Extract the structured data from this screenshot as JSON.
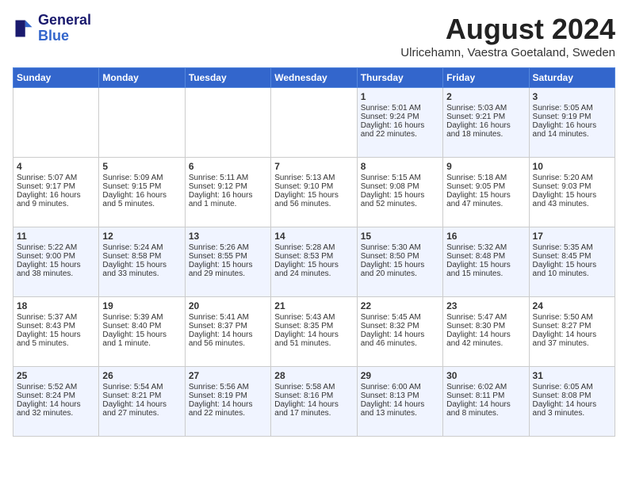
{
  "header": {
    "logo_line1": "General",
    "logo_line2": "Blue",
    "month": "August 2024",
    "location": "Ulricehamn, Vaestra Goetaland, Sweden"
  },
  "days_of_week": [
    "Sunday",
    "Monday",
    "Tuesday",
    "Wednesday",
    "Thursday",
    "Friday",
    "Saturday"
  ],
  "weeks": [
    [
      {
        "day": "",
        "info": ""
      },
      {
        "day": "",
        "info": ""
      },
      {
        "day": "",
        "info": ""
      },
      {
        "day": "",
        "info": ""
      },
      {
        "day": "1",
        "info": "Sunrise: 5:01 AM\nSunset: 9:24 PM\nDaylight: 16 hours\nand 22 minutes."
      },
      {
        "day": "2",
        "info": "Sunrise: 5:03 AM\nSunset: 9:21 PM\nDaylight: 16 hours\nand 18 minutes."
      },
      {
        "day": "3",
        "info": "Sunrise: 5:05 AM\nSunset: 9:19 PM\nDaylight: 16 hours\nand 14 minutes."
      }
    ],
    [
      {
        "day": "4",
        "info": "Sunrise: 5:07 AM\nSunset: 9:17 PM\nDaylight: 16 hours\nand 9 minutes."
      },
      {
        "day": "5",
        "info": "Sunrise: 5:09 AM\nSunset: 9:15 PM\nDaylight: 16 hours\nand 5 minutes."
      },
      {
        "day": "6",
        "info": "Sunrise: 5:11 AM\nSunset: 9:12 PM\nDaylight: 16 hours\nand 1 minute."
      },
      {
        "day": "7",
        "info": "Sunrise: 5:13 AM\nSunset: 9:10 PM\nDaylight: 15 hours\nand 56 minutes."
      },
      {
        "day": "8",
        "info": "Sunrise: 5:15 AM\nSunset: 9:08 PM\nDaylight: 15 hours\nand 52 minutes."
      },
      {
        "day": "9",
        "info": "Sunrise: 5:18 AM\nSunset: 9:05 PM\nDaylight: 15 hours\nand 47 minutes."
      },
      {
        "day": "10",
        "info": "Sunrise: 5:20 AM\nSunset: 9:03 PM\nDaylight: 15 hours\nand 43 minutes."
      }
    ],
    [
      {
        "day": "11",
        "info": "Sunrise: 5:22 AM\nSunset: 9:00 PM\nDaylight: 15 hours\nand 38 minutes."
      },
      {
        "day": "12",
        "info": "Sunrise: 5:24 AM\nSunset: 8:58 PM\nDaylight: 15 hours\nand 33 minutes."
      },
      {
        "day": "13",
        "info": "Sunrise: 5:26 AM\nSunset: 8:55 PM\nDaylight: 15 hours\nand 29 minutes."
      },
      {
        "day": "14",
        "info": "Sunrise: 5:28 AM\nSunset: 8:53 PM\nDaylight: 15 hours\nand 24 minutes."
      },
      {
        "day": "15",
        "info": "Sunrise: 5:30 AM\nSunset: 8:50 PM\nDaylight: 15 hours\nand 20 minutes."
      },
      {
        "day": "16",
        "info": "Sunrise: 5:32 AM\nSunset: 8:48 PM\nDaylight: 15 hours\nand 15 minutes."
      },
      {
        "day": "17",
        "info": "Sunrise: 5:35 AM\nSunset: 8:45 PM\nDaylight: 15 hours\nand 10 minutes."
      }
    ],
    [
      {
        "day": "18",
        "info": "Sunrise: 5:37 AM\nSunset: 8:43 PM\nDaylight: 15 hours\nand 5 minutes."
      },
      {
        "day": "19",
        "info": "Sunrise: 5:39 AM\nSunset: 8:40 PM\nDaylight: 15 hours\nand 1 minute."
      },
      {
        "day": "20",
        "info": "Sunrise: 5:41 AM\nSunset: 8:37 PM\nDaylight: 14 hours\nand 56 minutes."
      },
      {
        "day": "21",
        "info": "Sunrise: 5:43 AM\nSunset: 8:35 PM\nDaylight: 14 hours\nand 51 minutes."
      },
      {
        "day": "22",
        "info": "Sunrise: 5:45 AM\nSunset: 8:32 PM\nDaylight: 14 hours\nand 46 minutes."
      },
      {
        "day": "23",
        "info": "Sunrise: 5:47 AM\nSunset: 8:30 PM\nDaylight: 14 hours\nand 42 minutes."
      },
      {
        "day": "24",
        "info": "Sunrise: 5:50 AM\nSunset: 8:27 PM\nDaylight: 14 hours\nand 37 minutes."
      }
    ],
    [
      {
        "day": "25",
        "info": "Sunrise: 5:52 AM\nSunset: 8:24 PM\nDaylight: 14 hours\nand 32 minutes."
      },
      {
        "day": "26",
        "info": "Sunrise: 5:54 AM\nSunset: 8:21 PM\nDaylight: 14 hours\nand 27 minutes."
      },
      {
        "day": "27",
        "info": "Sunrise: 5:56 AM\nSunset: 8:19 PM\nDaylight: 14 hours\nand 22 minutes."
      },
      {
        "day": "28",
        "info": "Sunrise: 5:58 AM\nSunset: 8:16 PM\nDaylight: 14 hours\nand 17 minutes."
      },
      {
        "day": "29",
        "info": "Sunrise: 6:00 AM\nSunset: 8:13 PM\nDaylight: 14 hours\nand 13 minutes."
      },
      {
        "day": "30",
        "info": "Sunrise: 6:02 AM\nSunset: 8:11 PM\nDaylight: 14 hours\nand 8 minutes."
      },
      {
        "day": "31",
        "info": "Sunrise: 6:05 AM\nSunset: 8:08 PM\nDaylight: 14 hours\nand 3 minutes."
      }
    ]
  ]
}
